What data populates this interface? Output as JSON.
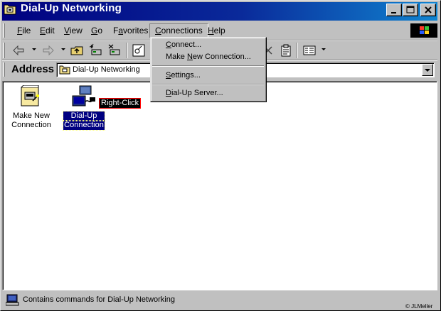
{
  "window": {
    "title": "Dial-Up Networking"
  },
  "menubar": {
    "items": [
      {
        "label": "File",
        "accel": "F",
        "rest": "ile"
      },
      {
        "label": "Edit",
        "accel": "E",
        "rest": "dit"
      },
      {
        "label": "View",
        "accel": "V",
        "rest": "iew"
      },
      {
        "label": "Go",
        "accel": "G",
        "rest": "o"
      },
      {
        "label": "Favorites",
        "pre": "F",
        "accel": "a",
        "rest": "vorites"
      },
      {
        "label": "Connections",
        "accel": "C",
        "rest": "onnections"
      },
      {
        "label": "Help",
        "accel": "H",
        "rest": "elp"
      }
    ]
  },
  "connections_menu": {
    "items": [
      {
        "label": "Connect...",
        "accel": "C",
        "rest": "onnect..."
      },
      {
        "label": "Make New Connection...",
        "pre": "Make ",
        "accel": "N",
        "rest": "ew Connection..."
      },
      {
        "label": "Settings...",
        "accel": "S",
        "rest": "ettings..."
      },
      {
        "label": "Dial-Up Server...",
        "accel": "D",
        "rest": "ial-Up Server..."
      }
    ]
  },
  "address": {
    "label": "Address",
    "value": "Dial-Up Networking"
  },
  "content": {
    "icons": [
      {
        "line1": "Make New",
        "line2": "Connection",
        "selected": false
      },
      {
        "line1": "Dial-Up",
        "line2": "Connection",
        "selected": true
      }
    ],
    "callout": "Right-Click"
  },
  "statusbar": {
    "text": "Contains commands for Dial-Up Networking",
    "copyright": "© JLMeller"
  },
  "colors": {
    "title_start": "#000080",
    "title_end": "#1084d0",
    "face": "#c0c0c0",
    "selection": "#000080",
    "callout_border": "#ff0000"
  }
}
